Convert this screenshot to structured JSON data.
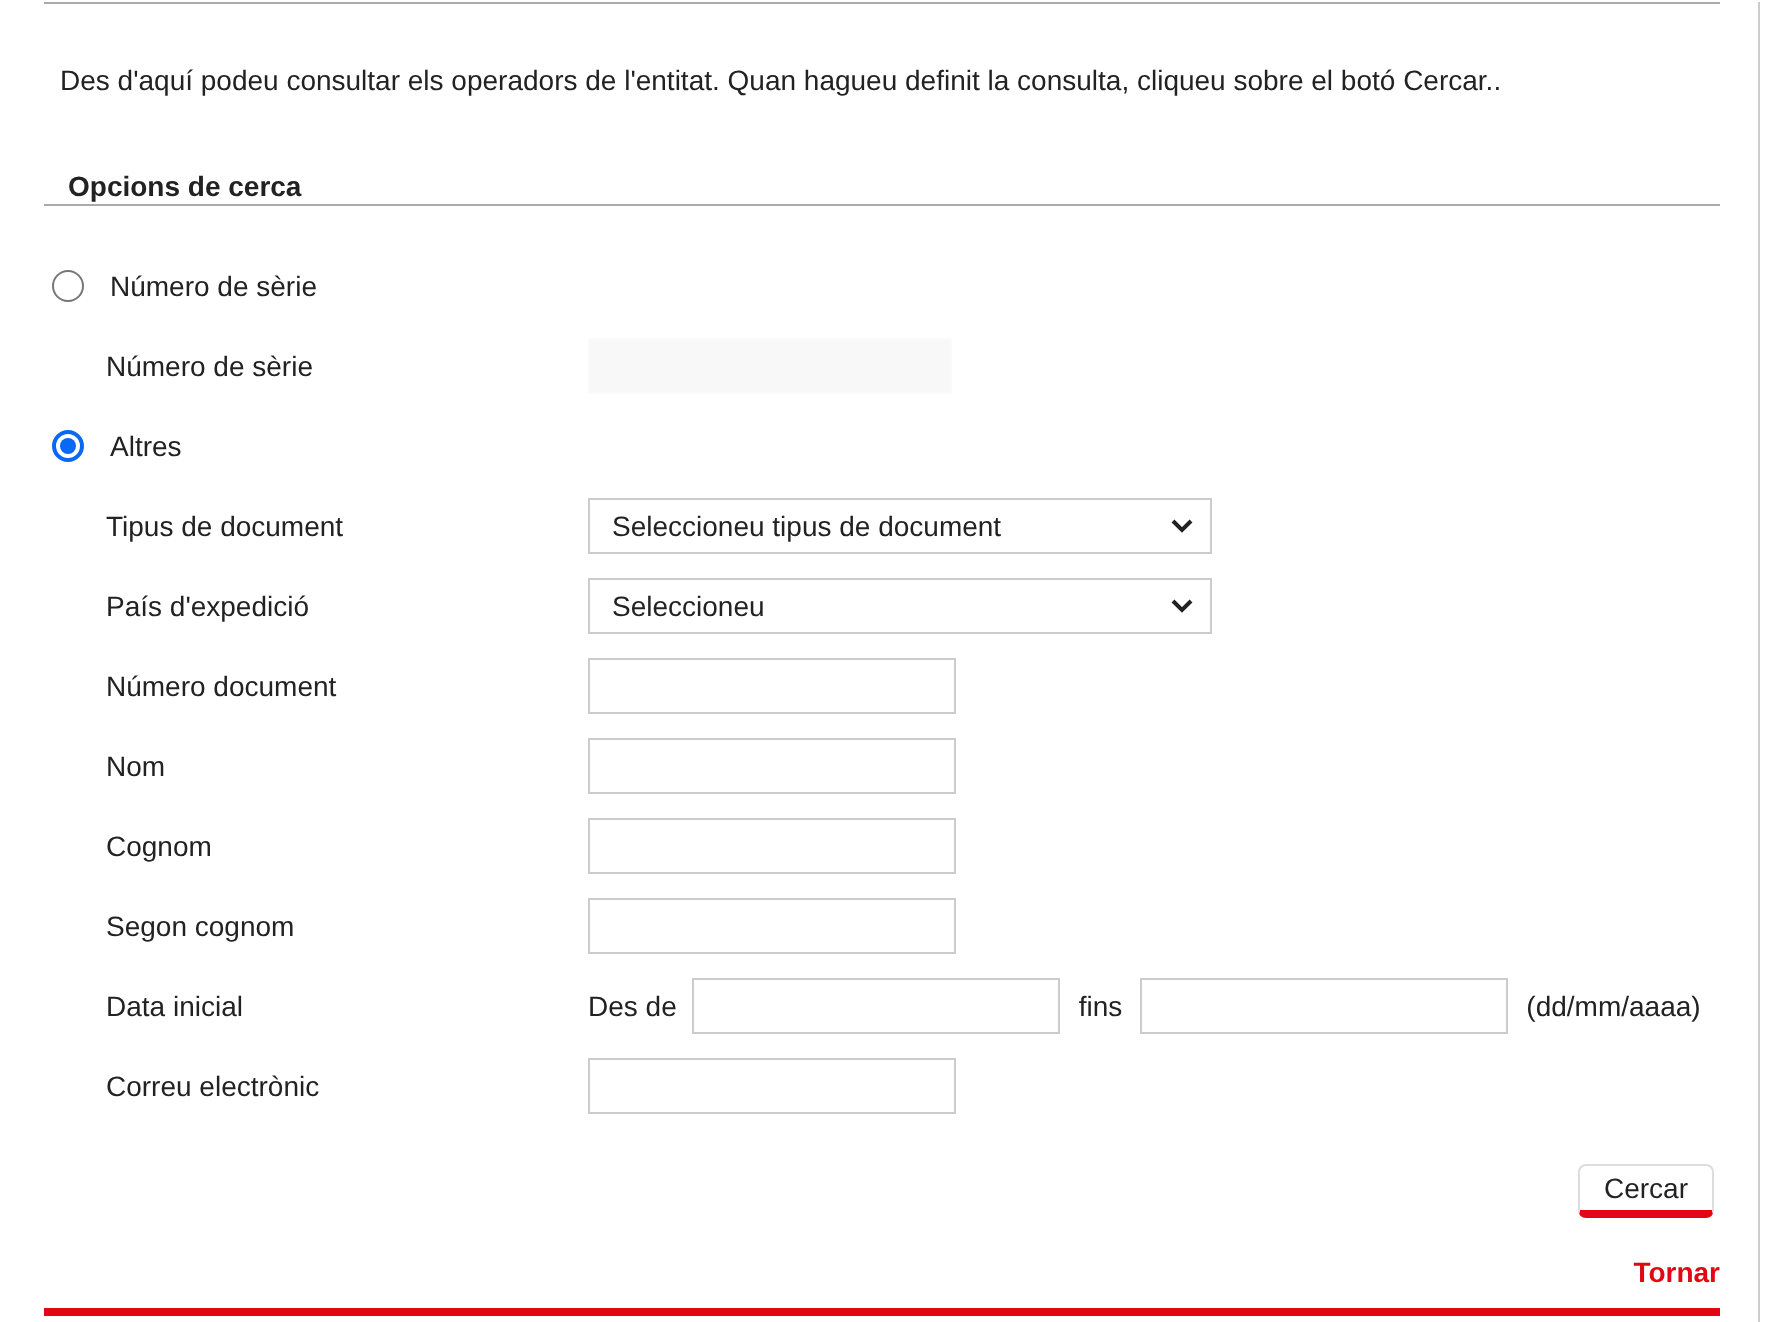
{
  "intro": "Des d'aquí podeu consultar els operadors de l'entitat. Quan hagueu definit la consulta, cliqueu sobre el botó Cercar..",
  "section_title": "Opcions de cerca",
  "rows": [
    {
      "kind": "radio",
      "label": "Número de sèrie",
      "selected": false
    },
    {
      "kind": "text",
      "label": "Número de sèrie",
      "disabled": true
    },
    {
      "kind": "radio",
      "label": "Altres",
      "selected": true
    },
    {
      "kind": "select",
      "label": "Tipus de document",
      "value": "Seleccioneu tipus de document"
    },
    {
      "kind": "select",
      "label": "País d'expedició",
      "value": "Seleccioneu"
    },
    {
      "kind": "text",
      "label": "Número document",
      "disabled": false
    },
    {
      "kind": "text",
      "label": "Nom",
      "disabled": false
    },
    {
      "kind": "text",
      "label": "Cognom",
      "disabled": false
    },
    {
      "kind": "text",
      "label": "Segon cognom",
      "disabled": false
    },
    {
      "kind": "daterange",
      "label": "Data inicial",
      "from_label": "Des de",
      "to_label": "fins",
      "hint": "(dd/mm/aaaa)"
    },
    {
      "kind": "text",
      "label": "Correu electrònic",
      "disabled": false
    }
  ],
  "search_button": "Cercar",
  "back_link": "Tornar"
}
